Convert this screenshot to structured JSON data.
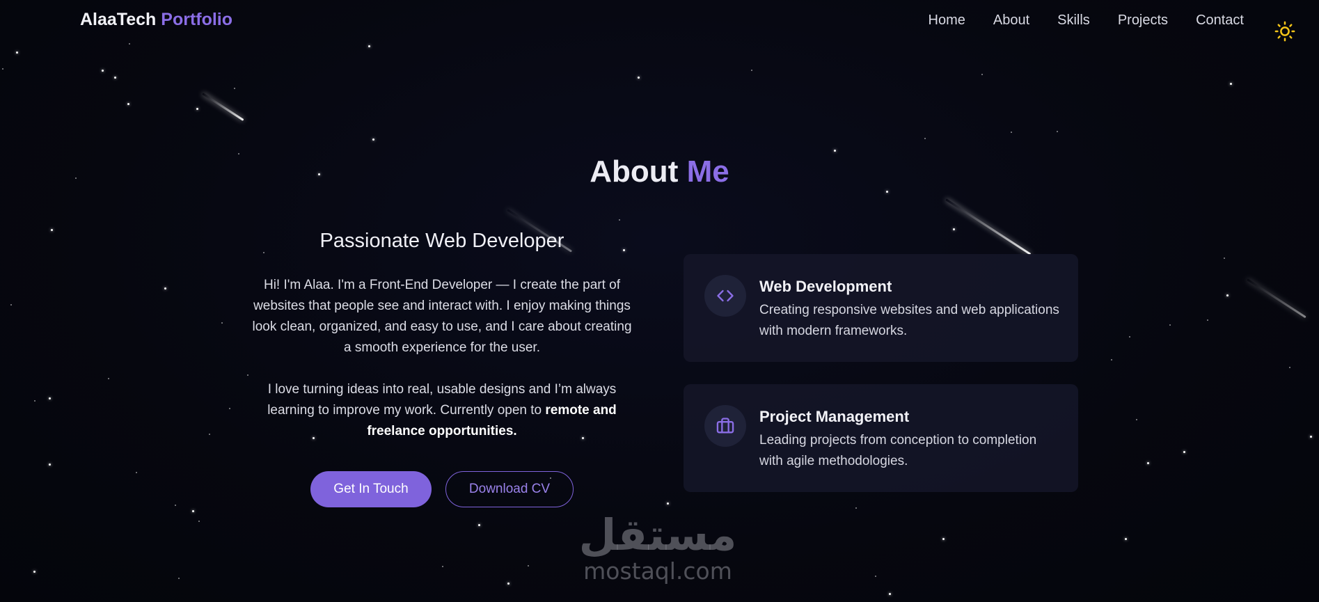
{
  "navbar": {
    "logo_main": "AlaaTech",
    "logo_accent": "Portfolio",
    "links": [
      "Home",
      "About",
      "Skills",
      "Projects",
      "Contact"
    ],
    "theme_icon": "sun-icon"
  },
  "section": {
    "title_main": "About",
    "title_accent": "Me"
  },
  "about": {
    "heading": "Passionate Web Developer",
    "paragraph_1": "Hi! I'm Alaa. I'm a Front-End Developer — I create the part of websites that people see and interact with. I enjoy making things look clean, organized, and easy to use, and I care about creating a smooth experience for the user.",
    "paragraph_2_start": "I love turning ideas into real, usable designs and I’m always learning to improve my work. Currently open to",
    "paragraph_2_strong": "remote and freelance opportunities.",
    "primary_button": "Get In Touch",
    "secondary_button": "Download CV"
  },
  "cards": [
    {
      "icon": "code-icon",
      "title": "Web Development",
      "description": "Creating responsive websites and web applications with modern frameworks."
    },
    {
      "icon": "briefcase-icon",
      "title": "Project Management",
      "description": "Leading projects from conception to completion with agile methodologies."
    }
  ],
  "watermark": {
    "arabic": "مستقل",
    "latin": "mostaql.com"
  },
  "colors": {
    "background": "#05060f",
    "accent": "#8b6ee6",
    "button": "#7f63dc",
    "card": "#141628",
    "theme_icon": "#f5c518"
  }
}
